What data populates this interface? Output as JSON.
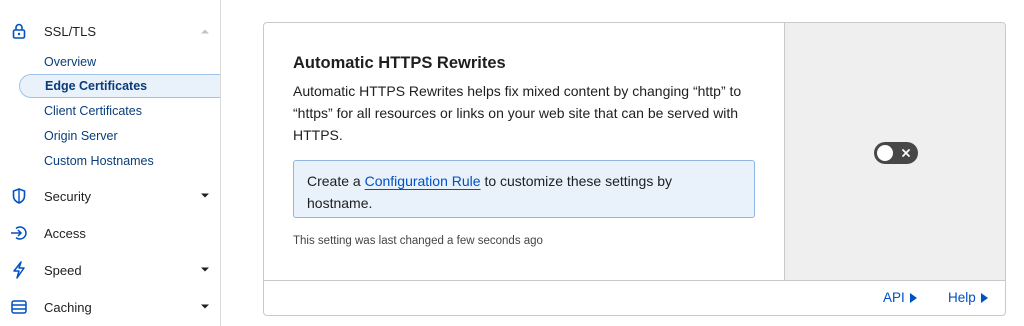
{
  "sidebar": {
    "ssl_tls": {
      "label": "SSL/TLS",
      "icon": "lock-icon",
      "expanded": true
    },
    "sub_items": [
      {
        "label": "Overview",
        "active": false
      },
      {
        "label": "Edge Certificates",
        "active": true
      },
      {
        "label": "Client Certificates",
        "active": false
      },
      {
        "label": "Origin Server",
        "active": false
      },
      {
        "label": "Custom Hostnames",
        "active": false
      }
    ],
    "groups": [
      {
        "label": "Security",
        "icon": "shield-icon",
        "has_caret": true
      },
      {
        "label": "Access",
        "icon": "access-icon",
        "has_caret": false
      },
      {
        "label": "Speed",
        "icon": "lightning-icon",
        "has_caret": true
      },
      {
        "label": "Caching",
        "icon": "caching-icon",
        "has_caret": true
      }
    ]
  },
  "card": {
    "title": "Automatic HTTPS Rewrites",
    "description": "Automatic HTTPS Rewrites helps fix mixed content by changing “http” to “https” for all resources or links on your web site that can be served with HTTPS.",
    "callout": {
      "prefix": "Create a ",
      "link": "Configuration Rule",
      "suffix": " to customize these settings by hostname."
    },
    "last_changed": "This setting was last changed a few seconds ago",
    "toggle_on": false
  },
  "footer": {
    "api_label": "API",
    "help_label": "Help"
  },
  "colors": {
    "accent": "#0051c3",
    "active_bg": "#e9f1fb",
    "toggle_off": "#474747"
  }
}
